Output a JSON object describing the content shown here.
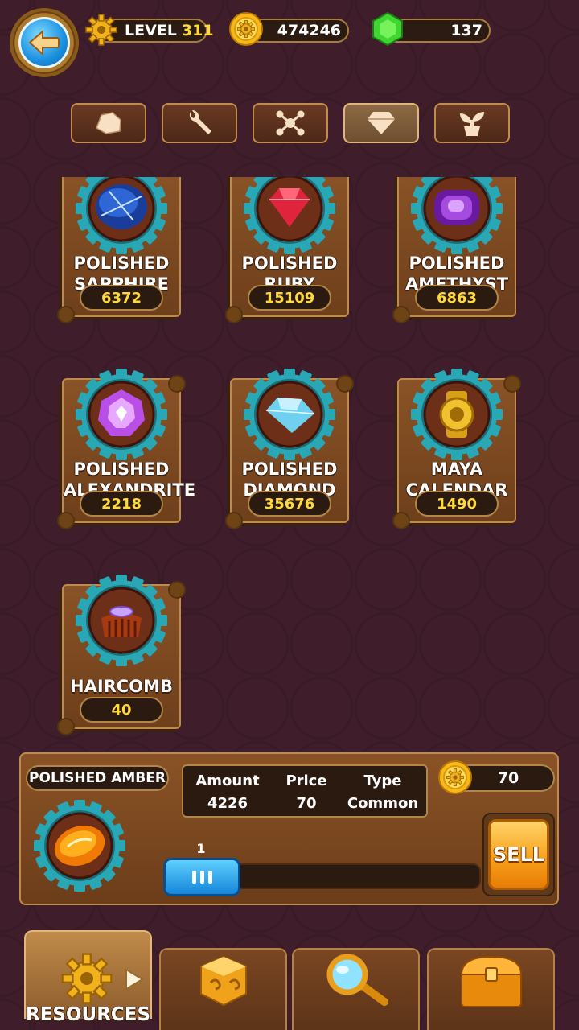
{
  "header": {
    "level_label": "LEVEL",
    "level_value": "311",
    "coins": "474246",
    "gems": "137"
  },
  "tabs": [
    {
      "name": "rock",
      "icon": "rock-icon",
      "active": false
    },
    {
      "name": "tools",
      "icon": "wrench-icon",
      "active": false
    },
    {
      "name": "molecule",
      "icon": "molecule-icon",
      "active": false
    },
    {
      "name": "gems",
      "icon": "diamond-icon",
      "active": true
    },
    {
      "name": "plants",
      "icon": "plant-icon",
      "active": false
    }
  ],
  "items": [
    {
      "name_line1": "POLISHED",
      "name_line2": "SAPPHIRE",
      "qty": "6372",
      "icon": "sapphire-icon"
    },
    {
      "name_line1": "POLISHED",
      "name_line2": "RUBY",
      "qty": "15109",
      "icon": "ruby-icon"
    },
    {
      "name_line1": "POLISHED",
      "name_line2": "AMETHYST",
      "qty": "6863",
      "icon": "amethyst-icon"
    },
    {
      "name_line1": "POLISHED",
      "name_line2": "ALEXANDRITE",
      "qty": "2218",
      "icon": "alexandrite-icon"
    },
    {
      "name_line1": "POLISHED",
      "name_line2": "DIAMOND",
      "qty": "35676",
      "icon": "diamond-gem-icon"
    },
    {
      "name_line1": "MAYA",
      "name_line2": "CALENDAR",
      "qty": "1490",
      "icon": "maya-calendar-icon"
    },
    {
      "name_line1": "HAIRCOMB",
      "name_line2": "",
      "qty": "40",
      "icon": "haircomb-icon"
    }
  ],
  "detail": {
    "name": "POLISHED AMBER",
    "amount_label": "Amount",
    "amount_value": "4226",
    "price_label": "Price",
    "price_value": "70",
    "type_label": "Type",
    "type_value": "Common",
    "total_price": "70",
    "slider_value": "1",
    "slider_fraction": 0.0,
    "sell_label": "SELL",
    "icon": "amber-icon"
  },
  "bottom_nav": [
    {
      "label": "RESOURCES",
      "icon": "gear-icon",
      "active": true
    },
    {
      "label": "",
      "icon": "dice-icon",
      "active": false
    },
    {
      "label": "",
      "icon": "magnifier-icon",
      "active": false
    },
    {
      "label": "",
      "icon": "chest-icon",
      "active": false
    }
  ],
  "colors": {
    "background": "#3f1d2b",
    "card": "#8a5326",
    "accent_yellow": "#ffd83a",
    "teal_gear": "#2aa7b5"
  }
}
